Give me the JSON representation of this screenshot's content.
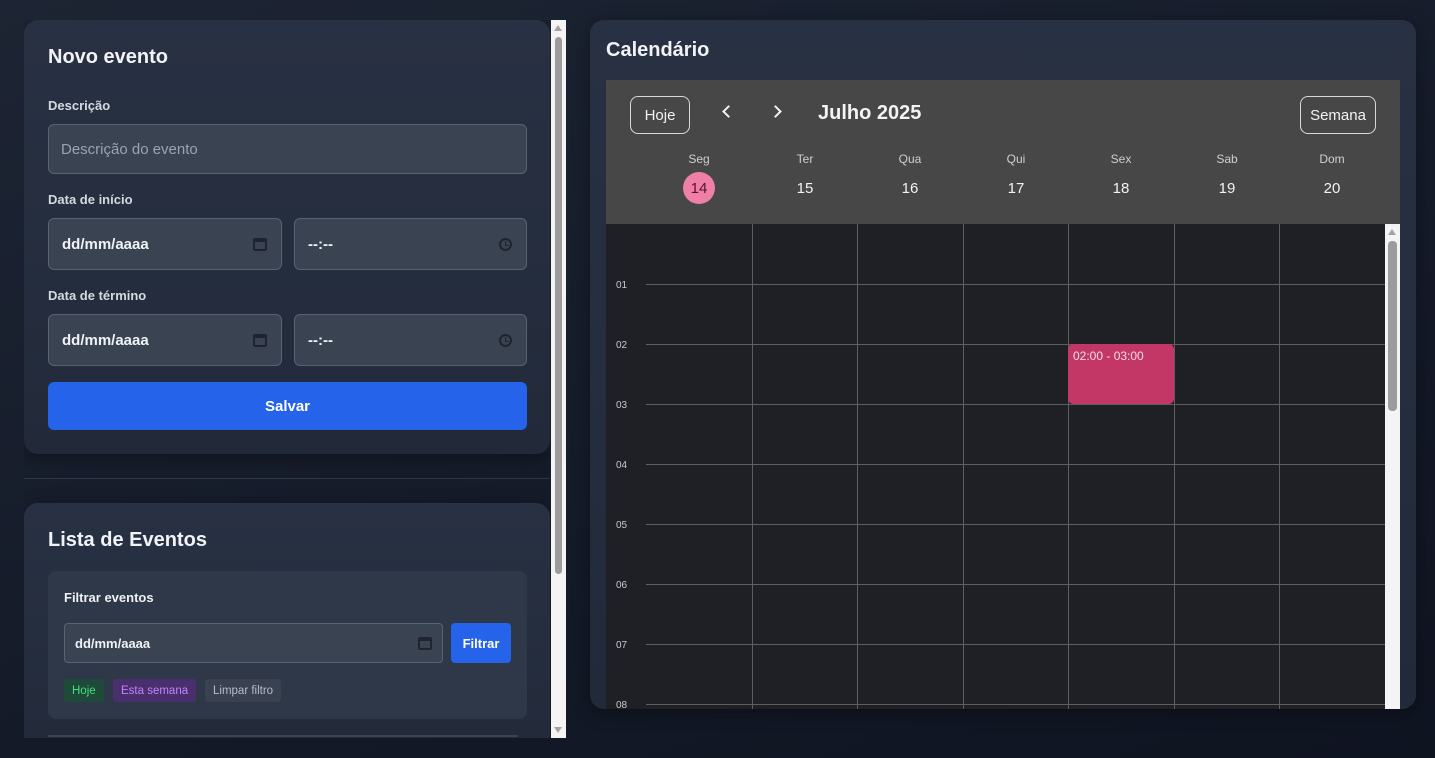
{
  "new_event": {
    "title": "Novo evento",
    "description_label": "Descrição",
    "description_placeholder": "Descrição do evento",
    "start_label": "Data de início",
    "start_date": "dd/mm/aaaa",
    "start_time": "--:--",
    "end_label": "Data de término",
    "end_date": "dd/mm/aaaa",
    "end_time": "--:--",
    "save_label": "Salvar"
  },
  "event_list": {
    "title": "Lista de Eventos",
    "filter_title": "Filtrar eventos",
    "filter_date": "dd/mm/aaaa",
    "filter_button": "Filtrar",
    "chips": {
      "today": "Hoje",
      "this_week": "Esta semana",
      "clear": "Limpar filtro"
    }
  },
  "calendar": {
    "title": "Calendário",
    "today_button": "Hoje",
    "month_label": "Julho 2025",
    "view_button": "Semana",
    "days": [
      {
        "name": "Seg",
        "num": "14",
        "current": true
      },
      {
        "name": "Ter",
        "num": "15",
        "current": false
      },
      {
        "name": "Qua",
        "num": "16",
        "current": false
      },
      {
        "name": "Qui",
        "num": "17",
        "current": false
      },
      {
        "name": "Sex",
        "num": "18",
        "current": false
      },
      {
        "name": "Sab",
        "num": "19",
        "current": false
      },
      {
        "name": "Dom",
        "num": "20",
        "current": false
      }
    ],
    "hours": [
      "01",
      "02",
      "03",
      "04",
      "05",
      "06",
      "07",
      "08"
    ],
    "event": {
      "time": "02:00 - 03:00",
      "day": "Sex"
    },
    "colors": {
      "current_day": "#f07fa7",
      "event": "#c23765",
      "primary_button": "#2563eb"
    }
  }
}
